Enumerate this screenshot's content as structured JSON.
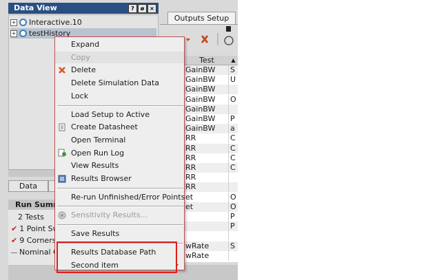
{
  "data_view": {
    "title": "Data View",
    "title_buttons": [
      "?",
      "ø",
      "×"
    ],
    "tree": [
      {
        "label": "Interactive.10",
        "selected": false
      },
      {
        "label": "testHistory",
        "selected": true
      }
    ],
    "tabs": [
      "Data",
      ""
    ]
  },
  "run_summary": {
    "title": "Run Summ",
    "items": [
      {
        "label": "2 Tests",
        "checked": false
      },
      {
        "label": "1 Point Sw",
        "checked": true
      },
      {
        "label": "9 Corners",
        "checked": true
      },
      {
        "label": "Nominal C",
        "checked": false
      }
    ]
  },
  "outputs": {
    "tab_label": "Outputs Setup",
    "column_header": "Test",
    "rows": [
      [
        "GainBW",
        "S"
      ],
      [
        "GainBW",
        "U"
      ],
      [
        "GainBW",
        ""
      ],
      [
        "GainBW",
        "O"
      ],
      [
        "GainBW",
        ""
      ],
      [
        "GainBW",
        "P"
      ],
      [
        "GainBW",
        "a"
      ],
      [
        "RR",
        "C"
      ],
      [
        "RR",
        "C"
      ],
      [
        "RR",
        "C"
      ],
      [
        "RR",
        "C"
      ],
      [
        "RR",
        ""
      ],
      [
        "RR",
        ""
      ],
      [
        "et",
        "O"
      ],
      [
        "et",
        "O"
      ],
      [
        "",
        "P"
      ],
      [
        "",
        "P"
      ],
      [
        "",
        ""
      ],
      [
        "wRate",
        "S"
      ],
      [
        "wRate",
        ""
      ]
    ]
  },
  "context_menu": {
    "items": [
      {
        "type": "item",
        "label": "Expand",
        "enabled": true,
        "icon": ""
      },
      {
        "type": "item",
        "label": "Copy",
        "enabled": false,
        "icon": ""
      },
      {
        "type": "item",
        "label": "Delete",
        "enabled": true,
        "icon": "delete-x-icon"
      },
      {
        "type": "item",
        "label": "Delete Simulation Data",
        "enabled": true,
        "icon": ""
      },
      {
        "type": "item",
        "label": "Lock",
        "enabled": true,
        "icon": ""
      },
      {
        "type": "separator"
      },
      {
        "type": "item",
        "label": "Load Setup to Active",
        "enabled": true,
        "icon": ""
      },
      {
        "type": "item",
        "label": "Create Datasheet",
        "enabled": true,
        "icon": "datasheet-icon"
      },
      {
        "type": "item",
        "label": "Open Terminal",
        "enabled": true,
        "icon": ""
      },
      {
        "type": "item",
        "label": "Open Run Log",
        "enabled": true,
        "icon": "run-log-icon"
      },
      {
        "type": "item",
        "label": "View Results",
        "enabled": true,
        "icon": ""
      },
      {
        "type": "item",
        "label": "Results Browser",
        "enabled": true,
        "icon": "results-browser-icon"
      },
      {
        "type": "separator"
      },
      {
        "type": "item",
        "label": "Re-run Unfinished/Error Points",
        "enabled": true,
        "icon": ""
      },
      {
        "type": "separator"
      },
      {
        "type": "item",
        "label": "Sensitivity Results...",
        "enabled": false,
        "icon": "sensitivity-icon"
      },
      {
        "type": "separator"
      },
      {
        "type": "item",
        "label": "Save Results",
        "enabled": true,
        "icon": ""
      },
      {
        "type": "separator"
      },
      {
        "type": "item",
        "label": "Results Database Path",
        "enabled": true,
        "icon": ""
      },
      {
        "type": "item",
        "label": "Second item",
        "enabled": true,
        "icon": "",
        "submenu": true
      }
    ]
  },
  "colors": {
    "title_bar": "#2a4f82",
    "highlight_box": "#e21d1d",
    "delete_icon": "#d4572a"
  }
}
